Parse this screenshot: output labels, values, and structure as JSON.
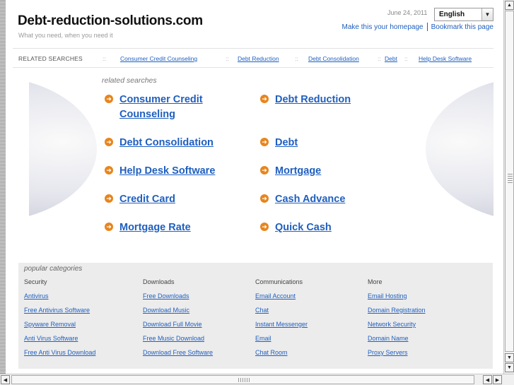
{
  "header": {
    "site_title": "Debt-reduction-solutions.com",
    "tagline": "What you need, when you need it",
    "date": "June 24, 2011",
    "language": "English",
    "homepage_link": "Make this your homepage",
    "bookmark_link": "Bookmark this page"
  },
  "related_bar": {
    "label": "RELATED SEARCHES",
    "separator": "::",
    "links": [
      "Consumer Credit Counseling",
      "Debt Reduction",
      "Debt Consolidation",
      "Debt",
      "Help Desk Software"
    ]
  },
  "related_searches": {
    "heading": "related searches",
    "items": [
      {
        "label_line1": "Consumer Credit",
        "label_line2": "Counseling"
      },
      {
        "label_line1": "Debt Reduction",
        "label_line2": ""
      },
      {
        "label_line1": "Debt Consolidation",
        "label_line2": ""
      },
      {
        "label_line1": "Debt",
        "label_line2": ""
      },
      {
        "label_line1": "Help Desk Software",
        "label_line2": ""
      },
      {
        "label_line1": "Mortgage",
        "label_line2": ""
      },
      {
        "label_line1": "Credit Card",
        "label_line2": ""
      },
      {
        "label_line1": "Cash Advance",
        "label_line2": ""
      },
      {
        "label_line1": "Mortgage Rate",
        "label_line2": ""
      },
      {
        "label_line1": "Quick Cash",
        "label_line2": ""
      }
    ]
  },
  "popular": {
    "heading": "popular categories",
    "columns": [
      {
        "title": "Security",
        "links": [
          "Antivirus",
          "Free Antivirus Software",
          "Spyware Removal",
          "Anti Virus Software",
          "Free Anti Virus Download"
        ]
      },
      {
        "title": "Downloads",
        "links": [
          "Free Downloads",
          "Download Music",
          "Download Full Movie",
          "Free Music Download",
          "Download Free Software"
        ]
      },
      {
        "title": "Communications",
        "links": [
          "Email Account",
          "Chat",
          "Instant Messenger",
          "Email",
          "Chat Room"
        ]
      },
      {
        "title": "More",
        "links": [
          "Email Hosting",
          "Domain Registration",
          "Network Security",
          "Domain Name",
          "Proxy Servers"
        ]
      }
    ]
  },
  "icons": {
    "bullet": "arrow-circle-icon",
    "dropdown": "chevron-down-icon",
    "scroll_up": "arrow-up-icon",
    "scroll_down": "arrow-down-icon",
    "scroll_left": "arrow-left-icon",
    "scroll_right": "arrow-right-icon"
  },
  "colors": {
    "link": "#1f5fbf",
    "bullet": "#e8851c",
    "panel": "#ececec"
  }
}
